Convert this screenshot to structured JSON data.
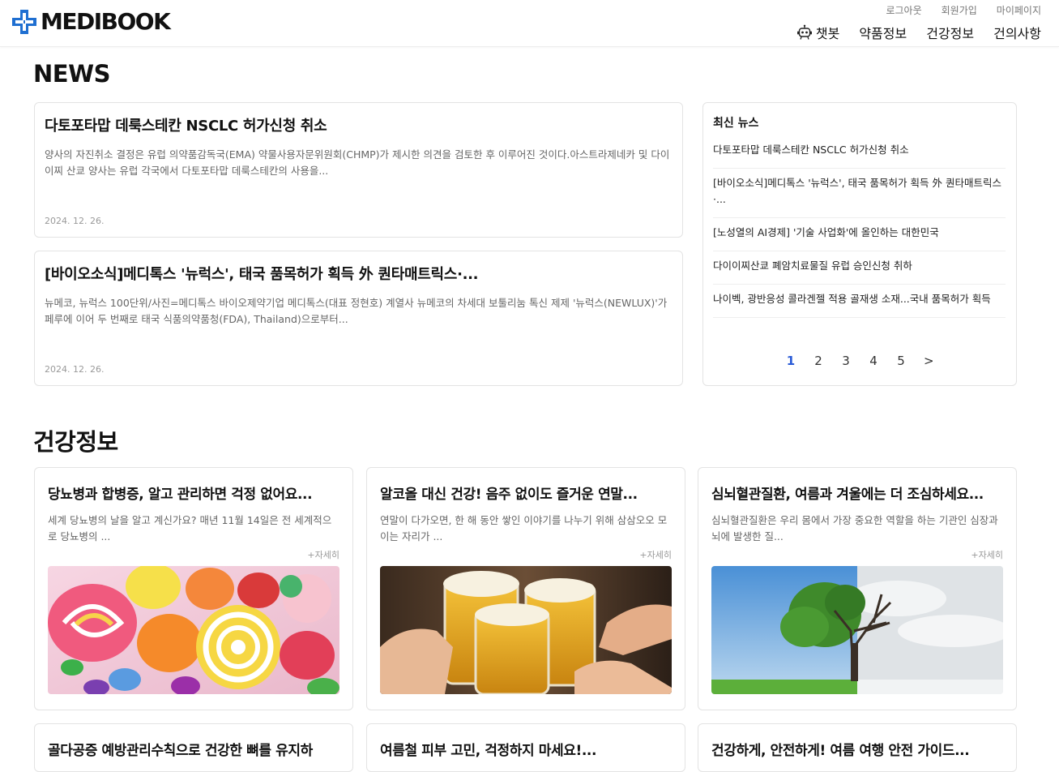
{
  "header": {
    "logo_text": "MEDIBOOK",
    "top_links": [
      "로그아웃",
      "회원가입",
      "마이페이지"
    ],
    "nav": [
      "챗봇",
      "약품정보",
      "건강정보",
      "건의사항"
    ]
  },
  "news": {
    "title": "NEWS",
    "cards": [
      {
        "headline": "다토포타맙 데룩스테칸 NSCLC 허가신청 취소",
        "summary": "양사의 자진취소 결정은 유럽 의약품감독국(EMA) 약물사용자문위원회(CHMP)가 제시한 의견을 검토한 후 이루어진 것이다.아스트라제네카 및 다이이찌 산쿄 양사는 유럽 각국에서 다토포타맙 데룩스테칸의 사용을...",
        "date": "2024. 12. 26."
      },
      {
        "headline": "[바이오소식]메디톡스 '뉴럭스', 태국 품목허가 획득 外 퀀타매트릭스·...",
        "summary": "뉴메코, 뉴럭스 100단위/사진=메디톡스 바이오제약기업 메디톡스(대표 정현호) 계열사 뉴메코의 차세대 보툴리눔 톡신 제제 '뉴럭스(NEWLUX)'가 페루에 이어 두 번째로 태국 식품의약품청(FDA), Thailand)으로부터...",
        "date": "2024. 12. 26."
      }
    ],
    "sidebar": {
      "title": "최신 뉴스",
      "items": [
        "다토포타맙 데룩스테칸 NSCLC 허가신청 취소",
        "[바이오소식]메디톡스 '뉴럭스', 태국 품목허가 획득 外 퀀타매트릭스·...",
        "[노성열의 AI경제] '기술 사업화'에 올인하는 대한민국",
        "다이이찌산쿄 폐암치료물질 유럽 승인신청 취하",
        "나이벡, 광반응성 콜라겐젤 적용 골재생 소재...국내 품목허가 획득"
      ],
      "pages": [
        "1",
        "2",
        "3",
        "4",
        "5",
        ">"
      ],
      "active_page": "1"
    }
  },
  "health": {
    "title": "건강정보",
    "more_label": "+자세히",
    "cards": [
      {
        "headline": "당뇨병과 합병증, 알고 관리하면 걱정 없어요...",
        "summary": "세계 당뇨병의 날을 알고 계신가요? 매년 11월 14일은 전 세계적으로 당뇨병의 ...",
        "image": "candy-image"
      },
      {
        "headline": "알코올 대신 건강! 음주 없이도 즐거운 연말...",
        "summary": "연말이 다가오면, 한 해 동안 쌓인 이야기를 나누기 위해 삼삼오오 모이는 자리가 ...",
        "image": "beer-image"
      },
      {
        "headline": "심뇌혈관질환, 여름과 겨울에는 더 조심하세요...",
        "summary": "심뇌혈관질환은 우리 몸에서 가장 중요한 역할을 하는 기관인 심장과 뇌에 발생한 질...",
        "image": "tree-image"
      }
    ],
    "cards_row2": [
      "골다공증 예방관리수칙으로 건강한 뼈를 유지하",
      "여름철 피부 고민, 걱정하지 마세요!...",
      "건강하게, 안전하게! 여름 여행 안전 가이드..."
    ]
  },
  "colors": {
    "brand_blue": "#1f6fd1",
    "active_page": "#2a5bd7"
  }
}
